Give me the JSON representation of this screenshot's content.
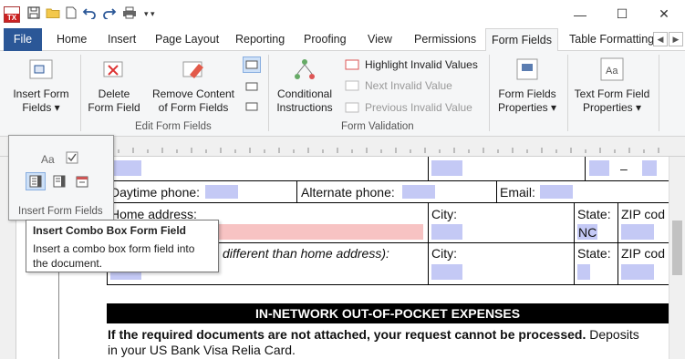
{
  "titlebar": {
    "app_icon_text": "TX",
    "qa_icons": [
      "save-icon",
      "open-folder-icon",
      "new-document-icon",
      "undo-icon",
      "redo-icon",
      "print-icon",
      "customize-dropdown-icon"
    ],
    "minimize": "—",
    "maximize": "☐",
    "close": "✕"
  },
  "tabs": [
    {
      "label": "File"
    },
    {
      "label": "Home"
    },
    {
      "label": "Insert"
    },
    {
      "label": "Page Layout"
    },
    {
      "label": "Reporting"
    },
    {
      "label": "Proofing"
    },
    {
      "label": "View"
    },
    {
      "label": "Permissions"
    },
    {
      "label": "Form Fields"
    },
    {
      "label": "Table Formatting"
    }
  ],
  "active_tab": "Form Fields",
  "ribbon": {
    "insert_form_fields": "Insert Form\nFields ▾",
    "delete_form_field": "Delete\nForm Field",
    "remove_content": "Remove Content\nof Form Fields",
    "edit_group": "Edit Form Fields",
    "conditional": "Conditional\nInstructions",
    "highlight": "Highlight Invalid Values",
    "next_invalid": "Next Invalid Value",
    "prev_invalid": "Previous Invalid Value",
    "validation_group": "Form Validation",
    "ff_properties": "Form Fields\nProperties ▾",
    "tf_properties": "Text Form Field\nProperties ▾"
  },
  "popup": {
    "group_label": "Insert Form Fields",
    "items": [
      "text-form-field-icon",
      "checkbox-form-field-icon",
      "combo-box-form-field-icon",
      "dropdown-form-field-icon",
      "date-form-field-icon"
    ]
  },
  "tooltip": {
    "title": "Insert Combo Box Form Field",
    "description": "Insert a combo box form field into the document."
  },
  "document": {
    "daytime": "Daytime phone:",
    "alternate": "Alternate phone:",
    "email": "Email:",
    "home_address": "Home address:",
    "city": "City:",
    "state": "State:",
    "state_value": "NC",
    "zip": "ZIP cod",
    "mailing_partial": "different than home address):",
    "city2": "City:",
    "state2": "State:",
    "zip2": "ZIP cod",
    "dash": "–",
    "section_header": "IN-NETWORK OUT-OF-POCKET EXPENSES",
    "notice_bold": "If the required documents are not attached, your request cannot be processed.",
    "notice_rest": " Deposits",
    "notice_line2": "in your US Bank Visa Relia Card."
  }
}
